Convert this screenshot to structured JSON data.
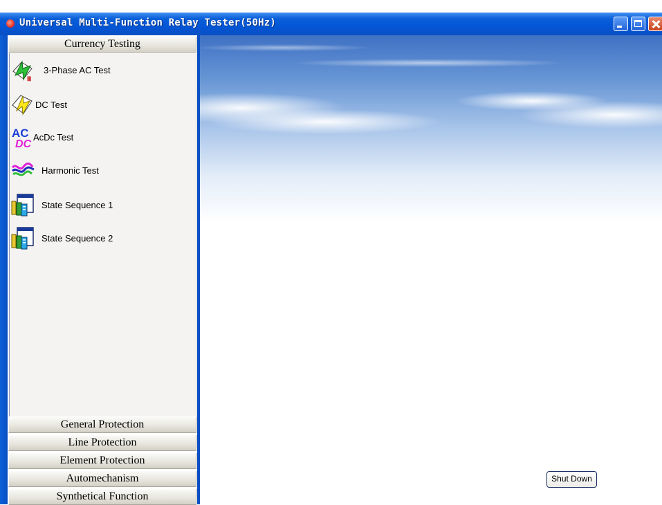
{
  "window": {
    "title": "Universal Multi-Function Relay Tester(50Hz)",
    "titlebar_color": "#0356d6"
  },
  "sidebar": {
    "active_group": "Currency Testing",
    "items": [
      {
        "label": "3-Phase AC Test",
        "icon": "three-phase-ac-icon"
      },
      {
        "label": "DC Test",
        "icon": "dc-lightning-icon"
      },
      {
        "label": "AcDc Test",
        "icon": "acdc-icon"
      },
      {
        "label": "Harmonic Test",
        "icon": "harmonic-wave-icon"
      },
      {
        "label": "State Sequence 1",
        "icon": "state-sequence-icon"
      },
      {
        "label": "State Sequence 2",
        "icon": "state-sequence-icon"
      }
    ],
    "groups": [
      "General Protection",
      "Line Protection",
      "Element Protection",
      "Automechanism",
      "Synthetical Function"
    ]
  },
  "main": {
    "shutdown_label": "Shut Down"
  }
}
